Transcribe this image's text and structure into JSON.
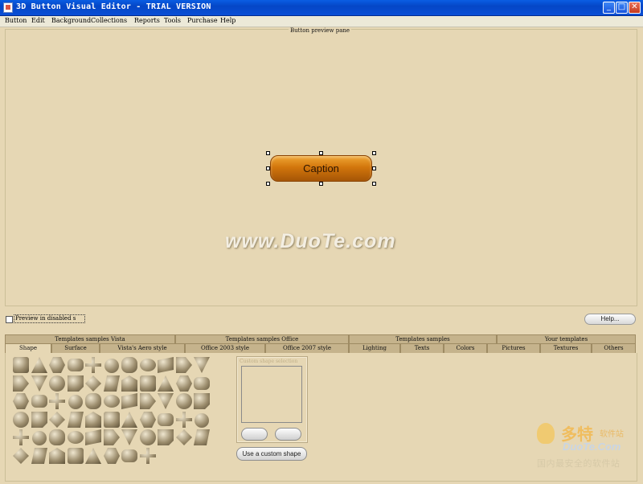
{
  "window": {
    "title": "3D Button Visual Editor - TRIAL VERSION",
    "minimize_glyph": "_",
    "maximize_glyph": "□",
    "close_glyph": "✕"
  },
  "menu": [
    "Button",
    "Edit",
    "Background",
    "Collections",
    "Reports",
    "Tools",
    "Purchase",
    "Help"
  ],
  "preview": {
    "label": "Button preview pane",
    "button_caption": "Caption",
    "watermark": "www.DuoTe.com"
  },
  "options": {
    "disabled_preview_label": "Preview in disabled s",
    "help_button": "Help..."
  },
  "tabs_top": [
    "Templates samples Vista",
    "Templates samples Office",
    "Templates samples",
    "Your templates"
  ],
  "tabs_bottom": [
    "Shape",
    "Surface",
    "Vista's Aero style",
    "Office 2003 style",
    "Office 2007 style",
    "Lighting",
    "Texts",
    "Colors",
    "Pictures",
    "Textures",
    "Others"
  ],
  "active_tab": "Shape",
  "custom_shape": {
    "label": "Custom shape selection",
    "use_button": "Use a custom shape"
  },
  "site_logo": {
    "chinese_name": "多特",
    "chinese_sub": "软件站",
    "domain": "DuoTe.Com",
    "slogan": "国内最安全的软件站"
  },
  "colors": {
    "title_bar": "#0446c6",
    "background": "#e6d7b4",
    "tab": "#c5b38c",
    "caption_button": "#d2760c"
  }
}
